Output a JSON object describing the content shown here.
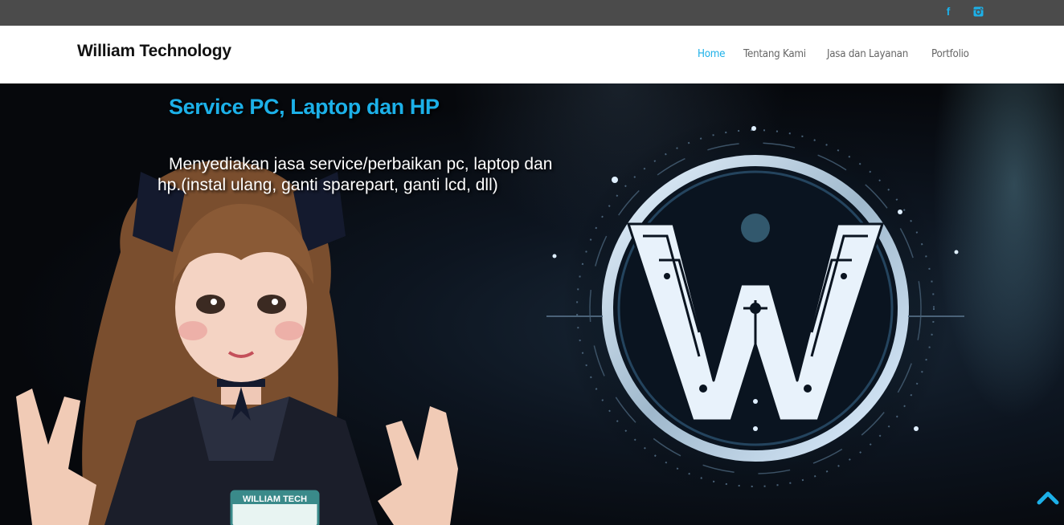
{
  "topbar": {
    "social": [
      {
        "icon": "facebook-icon",
        "glyph": "f"
      },
      {
        "icon": "instagram-icon"
      }
    ],
    "color": "#4b4b4b",
    "icon_color": "#1cb0e8"
  },
  "navbar": {
    "brand": "William Technology",
    "items": [
      {
        "label": "Home",
        "active": true
      },
      {
        "label": "Tentang Kami",
        "active": false
      },
      {
        "label": "Jasa dan Layanan",
        "active": false
      },
      {
        "label": "Portfolio",
        "active": false
      }
    ],
    "accent": "#1cb0e8"
  },
  "hero": {
    "title": "Service PC, Laptop dan HP",
    "description_line1": "Menyediakan jasa service/perbaikan pc, laptop dan",
    "description_line2": "hp.(instal ulang, ganti sparepart, ganti lcd, dll)",
    "logo_letter": "W",
    "badge_text": "WILLIAM TECH"
  },
  "scroll_top": {
    "icon": "chevron-up-icon"
  }
}
